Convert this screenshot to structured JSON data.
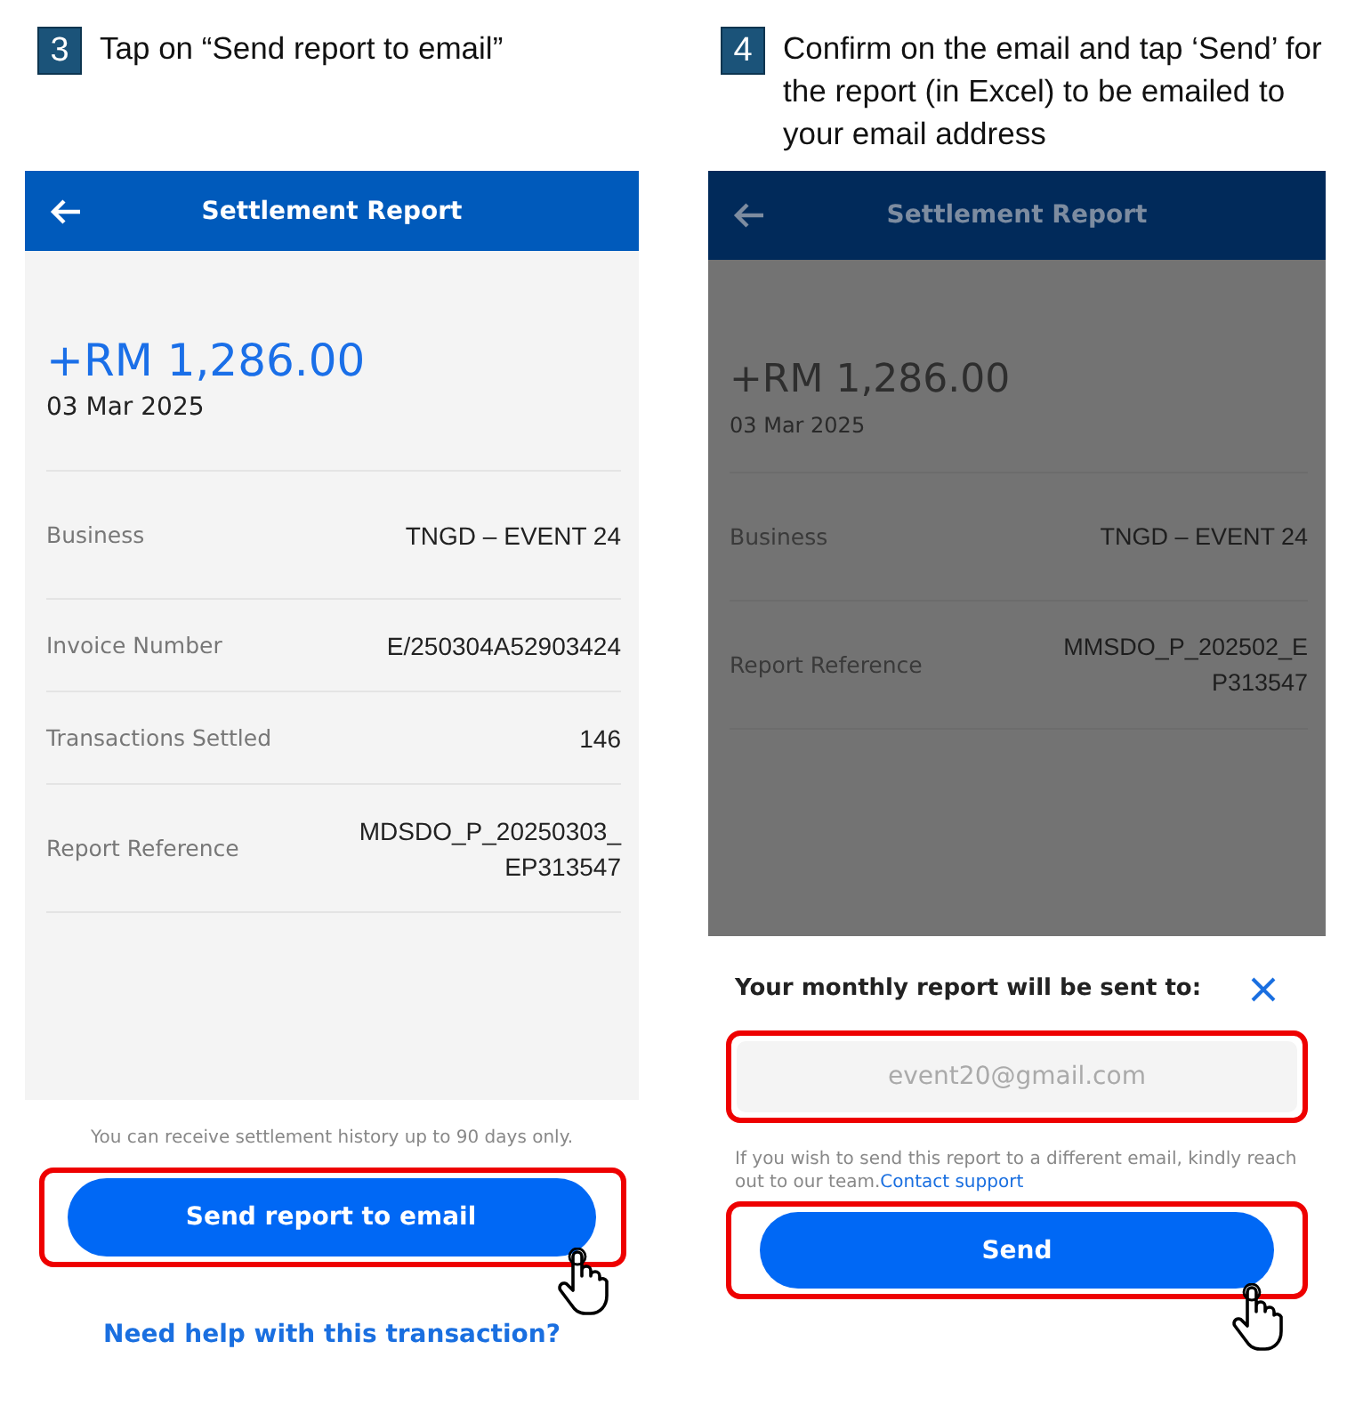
{
  "step_3": {
    "number": "3",
    "instruction": "Tap on “Send report to email”",
    "screen": {
      "dimmed": false,
      "header_title": "Settlement Report",
      "amount": "+RM 1,286.00",
      "date": "03 Mar 2025",
      "details": [
        {
          "label": "Business",
          "value_lines": [
            "TNGD – EVENT 24"
          ]
        },
        {
          "label": "Invoice Number",
          "value_lines": [
            "E/250304A52903424"
          ]
        },
        {
          "label": "Transactions Settled",
          "value_lines": [
            "146"
          ]
        },
        {
          "label": "Report Reference",
          "value_lines": [
            "MDSDO_P_20250303_",
            "EP313547"
          ]
        }
      ],
      "note": "You can receive settlement history up to 90 days only.",
      "primary_button": "Send report to email",
      "help_link": "Need help with this transaction?"
    }
  },
  "step_4": {
    "number": "4",
    "instruction": "Confirm on the email and  tap ‘Send’ for the report (in Excel) to be emailed to your email address",
    "screen": {
      "dimmed": true,
      "header_title": "Settlement Report",
      "amount": "+RM 1,286.00",
      "date": "03 Mar 2025",
      "details": [
        {
          "label": "Business",
          "value_lines": [
            "TNGD – EVENT 24"
          ]
        },
        {
          "label": "Report Reference",
          "value_lines": [
            "MMSDO_P_202502_E",
            "P313547"
          ]
        }
      ],
      "dialog": {
        "title": "Your monthly report will be sent to:",
        "email": "event20@gmail.com",
        "help_text": "If you wish to send this report to a different email, kindly reach out to our team.",
        "contact_link": "Contact support",
        "button": "Send"
      }
    }
  }
}
